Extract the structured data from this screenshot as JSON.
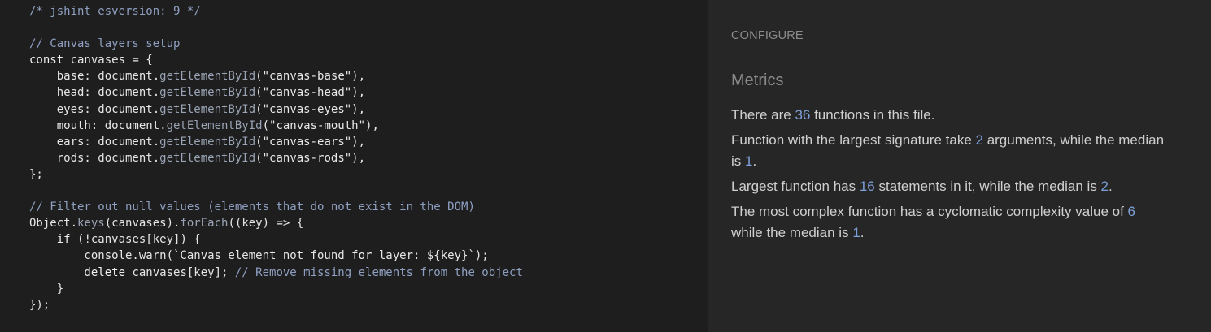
{
  "code": {
    "lines": [
      [
        {
          "t": "/* jshint esversion: 9 */",
          "c": "cm"
        }
      ],
      [],
      [
        {
          "t": "// Canvas layers setup",
          "c": "cm"
        }
      ],
      [
        {
          "t": "const ",
          "c": "kw"
        },
        {
          "t": "canvases = {",
          "c": "id"
        }
      ],
      [
        {
          "t": "    base: document.",
          "c": "id"
        },
        {
          "t": "getElementById",
          "c": "fn"
        },
        {
          "t": "(\"canvas-base\"),",
          "c": "str"
        }
      ],
      [
        {
          "t": "    head: document.",
          "c": "id"
        },
        {
          "t": "getElementById",
          "c": "fn"
        },
        {
          "t": "(\"canvas-head\"),",
          "c": "str"
        }
      ],
      [
        {
          "t": "    eyes: document.",
          "c": "id"
        },
        {
          "t": "getElementById",
          "c": "fn"
        },
        {
          "t": "(\"canvas-eyes\"),",
          "c": "str"
        }
      ],
      [
        {
          "t": "    mouth: document.",
          "c": "id"
        },
        {
          "t": "getElementById",
          "c": "fn"
        },
        {
          "t": "(\"canvas-mouth\"),",
          "c": "str"
        }
      ],
      [
        {
          "t": "    ears: document.",
          "c": "id"
        },
        {
          "t": "getElementById",
          "c": "fn"
        },
        {
          "t": "(\"canvas-ears\"),",
          "c": "str"
        }
      ],
      [
        {
          "t": "    rods: document.",
          "c": "id"
        },
        {
          "t": "getElementById",
          "c": "fn"
        },
        {
          "t": "(\"canvas-rods\"),",
          "c": "str"
        }
      ],
      [
        {
          "t": "};",
          "c": "id"
        }
      ],
      [],
      [
        {
          "t": "// Filter out null values (elements that do not exist in the DOM)",
          "c": "cm"
        }
      ],
      [
        {
          "t": "Object.",
          "c": "id"
        },
        {
          "t": "keys",
          "c": "fn"
        },
        {
          "t": "(canvases).",
          "c": "id"
        },
        {
          "t": "forEach",
          "c": "fn"
        },
        {
          "t": "((key) => {",
          "c": "id"
        }
      ],
      [
        {
          "t": "    if ",
          "c": "kw"
        },
        {
          "t": "(!canvases[key]) {",
          "c": "id"
        }
      ],
      [
        {
          "t": "        console.warn(`Canvas element not found ",
          "c": "id"
        },
        {
          "t": "for",
          "c": "kw"
        },
        {
          "t": " layer: ${key}`);",
          "c": "id"
        }
      ],
      [
        {
          "t": "        delete ",
          "c": "kw"
        },
        {
          "t": "canvases[key]; ",
          "c": "id"
        },
        {
          "t": "// Remove missing elements from the object",
          "c": "cm"
        }
      ],
      [
        {
          "t": "    }",
          "c": "id"
        }
      ],
      [
        {
          "t": "});",
          "c": "id"
        }
      ]
    ]
  },
  "panel": {
    "configure_label": "CONFIGURE",
    "metrics_title": "Metrics",
    "m1_a": "There are ",
    "m1_n": "36",
    "m1_b": " functions in this file.",
    "m2_a": "Function with the largest signature take ",
    "m2_n1": "2",
    "m2_b": " arguments, while the median is ",
    "m2_n2": "1",
    "m2_c": ".",
    "m3_a": "Largest function has ",
    "m3_n1": "16",
    "m3_b": " statements in it, while the median is ",
    "m3_n2": "2",
    "m3_c": ".",
    "m4_a": "The most complex function has a cyclomatic complexity value of ",
    "m4_n1": "6",
    "m4_b": " while the median is ",
    "m4_n2": "1",
    "m4_c": "."
  }
}
